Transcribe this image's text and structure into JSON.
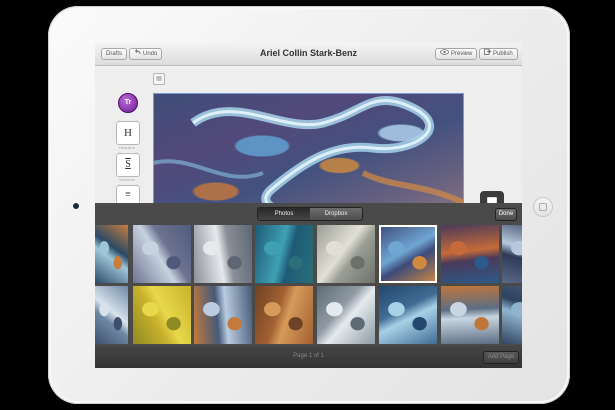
{
  "toolbar": {
    "drafts_label": "Drafts",
    "undo_label": "Undo",
    "undo_icon": "undo-arrow-icon",
    "title": "Ariel Collin Stark-Benz",
    "preview_label": "Preview",
    "preview_icon": "eye-icon",
    "publish_label": "Publish",
    "publish_icon": "publish-icon"
  },
  "editor": {
    "avatar_initials": "Tr",
    "tools": [
      "H",
      "S",
      "≡"
    ],
    "tool_captions": [
      "Headline",
      "Subhead"
    ]
  },
  "picker": {
    "tabs": [
      "Photos",
      "Dropbox"
    ],
    "active_tab": "Photos",
    "done_label": "Done",
    "thumbnails": [
      {
        "colors": [
          "#2a4a66",
          "#9fc6d8",
          "#c87d3c"
        ]
      },
      {
        "colors": [
          "#6d7390",
          "#c7d3e0",
          "#505a7c"
        ]
      },
      {
        "colors": [
          "#8a8f98",
          "#e7e9ec",
          "#5d6672"
        ]
      },
      {
        "colors": [
          "#1e5a76",
          "#3fa0b4",
          "#2a6f7a"
        ]
      },
      {
        "colors": [
          "#9a9e94",
          "#e2e0d6",
          "#6d7268"
        ]
      },
      {
        "colors": [
          "#3e4a7a",
          "#6fa6d2",
          "#d08a40"
        ],
        "selected": true
      },
      {
        "colors": [
          "#4a3a5a",
          "#c56a3a",
          "#2c5a8a"
        ]
      },
      {
        "colors": [
          "#2f3b56",
          "#b7c8de",
          "#5a6a8a"
        ]
      },
      {
        "colors": [
          "#6f88a5",
          "#d8e2ec",
          "#3d4f6b"
        ]
      },
      {
        "colors": [
          "#c9b22c",
          "#e8d84a",
          "#8f8a22"
        ]
      },
      {
        "colors": [
          "#465a78",
          "#b9cce0",
          "#c47a3a"
        ]
      },
      {
        "colors": [
          "#a26032",
          "#d69a5a",
          "#6e4226"
        ]
      },
      {
        "colors": [
          "#8f9aa4",
          "#e4eaee",
          "#5e6a76"
        ]
      },
      {
        "colors": [
          "#3f6c94",
          "#a8d0e6",
          "#23476e"
        ]
      },
      {
        "colors": [
          "#5c6e84",
          "#c8d6e2",
          "#c0763a"
        ]
      },
      {
        "colors": [
          "#30435e",
          "#8fb4d0",
          "#4d5f7c"
        ]
      }
    ],
    "page_label": "Page 1 of 1",
    "add_label": "Add Page"
  }
}
